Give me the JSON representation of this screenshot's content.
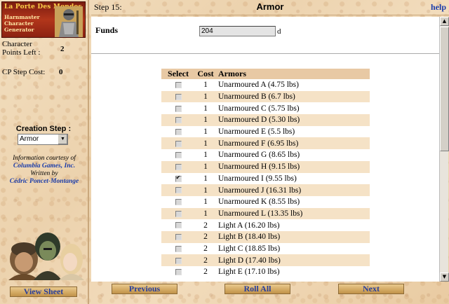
{
  "sidebar": {
    "logo": {
      "line1": "La Porte Des Mondes",
      "line2": "Harnmaster Character Generator"
    },
    "points_left_label": "Character Points Left :",
    "points_left_value": "2",
    "cp_step_cost_label": "CP Step Cost:",
    "cp_step_cost_value": "0",
    "creation_step_label": "Creation Step :",
    "creation_step_value": "Armor",
    "info_line1": "Information courtesy of",
    "info_company": "Columbia Games, Inc.",
    "info_written_by": "Written by",
    "info_author": "Cédric Poncet-Montange",
    "view_sheet_label": "View Sheet"
  },
  "header": {
    "step": "Step 15:",
    "title": "Armor",
    "help": "help"
  },
  "funds": {
    "label": "Funds",
    "value": "204",
    "unit": "d"
  },
  "table": {
    "headers": [
      "Select",
      "Cost",
      "Armors"
    ],
    "rows": [
      {
        "cost": "1",
        "name": "Unarmoured A (4.75 lbs)",
        "checked": false
      },
      {
        "cost": "1",
        "name": "Unarmoured B (6.7 lbs)",
        "checked": false
      },
      {
        "cost": "1",
        "name": "Unarmoured C (5.75 lbs)",
        "checked": false
      },
      {
        "cost": "1",
        "name": "Unarmoured D (5.30 lbs)",
        "checked": false
      },
      {
        "cost": "1",
        "name": "Unarmoured E (5.5 lbs)",
        "checked": false
      },
      {
        "cost": "1",
        "name": "Unarmoured F (6.95 lbs)",
        "checked": false
      },
      {
        "cost": "1",
        "name": "Unarmoured G (8.65 lbs)",
        "checked": false
      },
      {
        "cost": "1",
        "name": "Unarmoured H (9.15 lbs)",
        "checked": false
      },
      {
        "cost": "1",
        "name": "Unarmoured I (9.55 lbs)",
        "checked": true
      },
      {
        "cost": "1",
        "name": "Unarmoured J (16.31 lbs)",
        "checked": false
      },
      {
        "cost": "1",
        "name": "Unarmoured K (8.55 lbs)",
        "checked": false
      },
      {
        "cost": "1",
        "name": "Unarmoured L (13.35 lbs)",
        "checked": false
      },
      {
        "cost": "2",
        "name": "Light A (16.20 lbs)",
        "checked": false
      },
      {
        "cost": "2",
        "name": "Light B (18.40 lbs)",
        "checked": false
      },
      {
        "cost": "2",
        "name": "Light C (18.85 lbs)",
        "checked": false
      },
      {
        "cost": "2",
        "name": "Light D (17.40 lbs)",
        "checked": false
      },
      {
        "cost": "2",
        "name": "Light E (17.10 lbs)",
        "checked": false
      }
    ]
  },
  "footer": {
    "previous": "Previous",
    "roll_all": "Roll All",
    "next": "Next"
  },
  "icons": {
    "dropdown": "chevron-down-icon",
    "scroll_up": "arrow-up-icon",
    "scroll_down": "arrow-down-icon"
  }
}
